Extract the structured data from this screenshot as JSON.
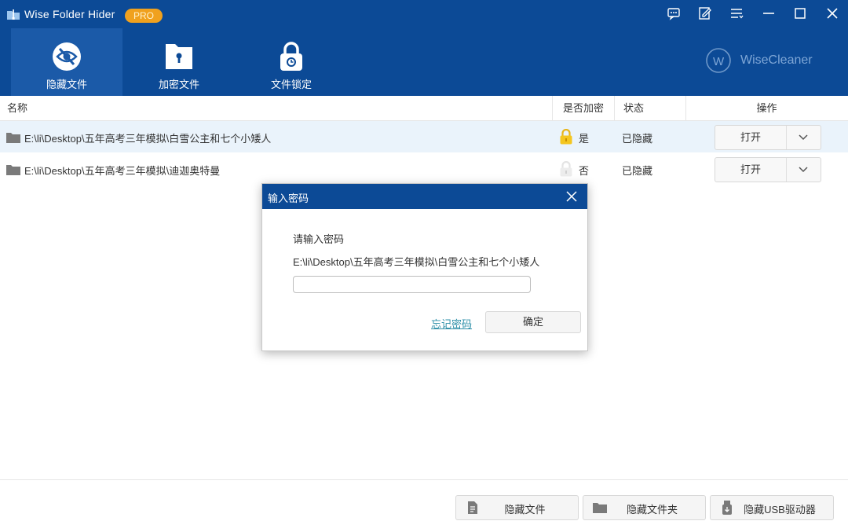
{
  "app": {
    "title": "Wise Folder Hider",
    "badge": "PRO",
    "brand": "WiseCleaner",
    "colors": {
      "header": "#0c4a96",
      "active_tab": "#1b5aa8",
      "badge": "#f0a11e",
      "link": "#2d8fa8"
    }
  },
  "window_controls": [
    {
      "name": "feedback-icon"
    },
    {
      "name": "edit-icon"
    },
    {
      "name": "menu-icon"
    },
    {
      "name": "minimize-icon"
    },
    {
      "name": "maximize-icon"
    },
    {
      "name": "close-icon"
    }
  ],
  "tabs": [
    {
      "label": "隐藏文件",
      "icon": "eye-slash-icon",
      "active": true
    },
    {
      "label": "加密文件",
      "icon": "encrypted-file-icon",
      "active": false
    },
    {
      "label": "文件锁定",
      "icon": "padlock-icon",
      "active": false
    }
  ],
  "table": {
    "headers": {
      "name": "名称",
      "encrypted": "是否加密",
      "status": "状态",
      "action": "操作"
    },
    "rows": [
      {
        "path": "E:\\li\\Desktop\\五年高考三年模拟\\白雪公主和七个小矮人",
        "encrypted": "是",
        "status": "已隐藏",
        "open": "打开",
        "locked": true,
        "selected": true
      },
      {
        "path": "E:\\li\\Desktop\\五年高考三年模拟\\迪迦奥特曼",
        "encrypted": "否",
        "status": "已隐藏",
        "open": "打开",
        "locked": false,
        "selected": false
      }
    ]
  },
  "footer": {
    "buttons": [
      {
        "label": "隐藏文件",
        "icon": "file-icon"
      },
      {
        "label": "隐藏文件夹",
        "icon": "folder-icon"
      },
      {
        "label": "隐藏USB驱动器",
        "icon": "usb-drive-icon"
      }
    ]
  },
  "modal": {
    "title": "输入密码",
    "prompt": "请输入密码",
    "path": "E:\\li\\Desktop\\五年高考三年模拟\\白雪公主和七个小矮人",
    "password_value": "",
    "forgot": "忘记密码",
    "ok": "确定"
  }
}
